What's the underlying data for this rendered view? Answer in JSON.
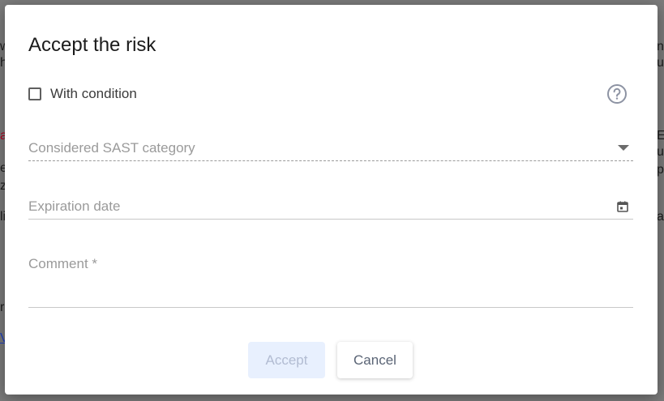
{
  "background": {
    "fragments_left": [
      "w",
      "h",
      "a",
      "e",
      "e",
      "z",
      "li",
      "r",
      "V"
    ],
    "fragments_right": [
      "nt",
      "ui",
      "Ex",
      "u",
      "pi",
      "ac"
    ]
  },
  "dialog": {
    "title": "Accept the risk",
    "with_condition": {
      "label": "With condition",
      "checked": false
    },
    "help_icon": "question-circle-icon",
    "sast_category": {
      "placeholder": "Considered SAST category",
      "value": ""
    },
    "expiration_date": {
      "placeholder": "Expiration date",
      "value": "",
      "icon": "calendar-icon"
    },
    "comment": {
      "placeholder": "Comment *",
      "value": ""
    },
    "buttons": {
      "accept": "Accept",
      "cancel": "Cancel"
    }
  },
  "colors": {
    "accent_disabled_bg": "#e8f0fe",
    "overlay": "#7b7b7b"
  }
}
